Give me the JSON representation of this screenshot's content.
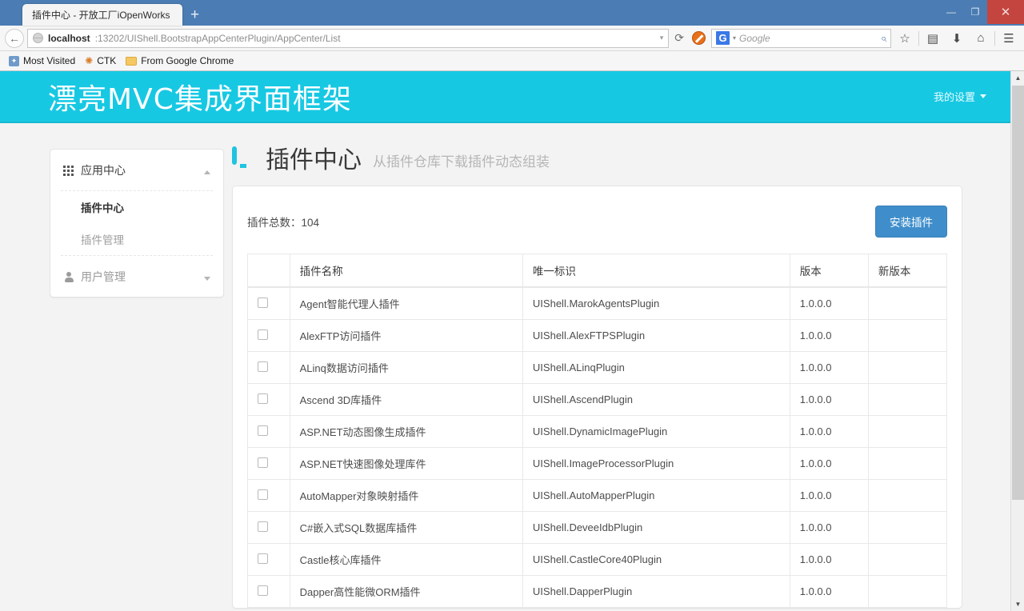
{
  "browser": {
    "tab_title": "插件中心 - 开放工厂iOpenWorks",
    "new_tab_label": "+",
    "back_icon": "←",
    "url_host": "localhost",
    "url_rest": ":13202/UIShell.BootstrapAppCenterPlugin/AppCenter/List",
    "url_caret": "▾",
    "reload_icon": "⟳",
    "search_engine": "G",
    "search_placeholder": "Google",
    "search_caret": "▾",
    "search_icon": "⌕",
    "bookmark_star": "☆",
    "reader_icon": "▤",
    "download_icon": "⬇",
    "home_icon": "⌂",
    "menu_icon": "☰",
    "minimize": "—",
    "maximize": "❐",
    "close": "✕",
    "bookmarks": [
      {
        "label": "Most Visited",
        "icon": "bookmark-blue-icon"
      },
      {
        "label": "CTK",
        "icon": "bookmark-star-icon"
      },
      {
        "label": "From Google Chrome",
        "icon": "folder-icon"
      }
    ]
  },
  "site": {
    "title": "漂亮MVC集成界面框架",
    "header_bg": "#17c8e3",
    "nav": {
      "settings_label": "我的设置"
    }
  },
  "sidebar": {
    "groups": [
      {
        "label": "应用中心",
        "icon": "grid-icon",
        "expanded": true,
        "chevron": "caret-up",
        "items": [
          {
            "label": "插件中心",
            "active": true
          },
          {
            "label": "插件管理",
            "active": false
          }
        ]
      },
      {
        "label": "用户管理",
        "icon": "person-icon",
        "expanded": false,
        "chevron": "caret-down",
        "items": []
      }
    ]
  },
  "main": {
    "icon": "monitor-icon",
    "title": "插件中心",
    "subtitle": "从插件仓库下载插件动态组装",
    "toolbar": {
      "total_label": "插件总数：104",
      "install_button": "安装插件",
      "install_button_color": "#3f8ecb"
    },
    "table": {
      "headers": [
        "",
        "插件名称",
        "唯一标识",
        "版本",
        "新版本"
      ],
      "rows": [
        {
          "name": "Agent智能代理人插件",
          "id": "UIShell.MarokAgentsPlugin",
          "version": "1.0.0.0",
          "new_version": ""
        },
        {
          "name": "AlexFTP访问插件",
          "id": "UIShell.AlexFTPSPlugin",
          "version": "1.0.0.0",
          "new_version": ""
        },
        {
          "name": "ALinq数据访问插件",
          "id": "UIShell.ALinqPlugin",
          "version": "1.0.0.0",
          "new_version": ""
        },
        {
          "name": "Ascend 3D库插件",
          "id": "UIShell.AscendPlugin",
          "version": "1.0.0.0",
          "new_version": ""
        },
        {
          "name": "ASP.NET动态图像生成插件",
          "id": "UIShell.DynamicImagePlugin",
          "version": "1.0.0.0",
          "new_version": ""
        },
        {
          "name": "ASP.NET快速图像处理库件",
          "id": "UIShell.ImageProcessorPlugin",
          "version": "1.0.0.0",
          "new_version": ""
        },
        {
          "name": "AutoMapper对象映射插件",
          "id": "UIShell.AutoMapperPlugin",
          "version": "1.0.0.0",
          "new_version": ""
        },
        {
          "name": "C#嵌入式SQL数据库插件",
          "id": "UIShell.DeveeIdbPlugin",
          "version": "1.0.0.0",
          "new_version": ""
        },
        {
          "name": "Castle核心库插件",
          "id": "UIShell.CastleCore40Plugin",
          "version": "1.0.0.0",
          "new_version": ""
        },
        {
          "name": "Dapper高性能微ORM插件",
          "id": "UIShell.DapperPlugin",
          "version": "1.0.0.0",
          "new_version": ""
        }
      ]
    }
  },
  "scrollbar": {
    "up_arrow": "▲",
    "down_arrow": "▼"
  }
}
